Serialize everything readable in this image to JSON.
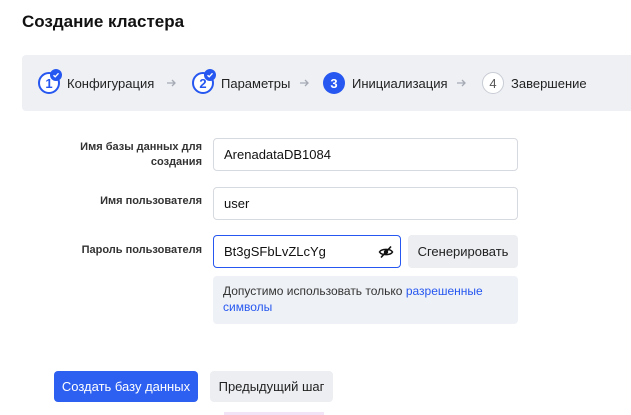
{
  "page": {
    "title": "Создание кластера"
  },
  "stepper": {
    "steps": [
      {
        "number": "1",
        "label": "Конфигурация",
        "state": "done"
      },
      {
        "number": "2",
        "label": "Параметры",
        "state": "done"
      },
      {
        "number": "3",
        "label": "Инициализация",
        "state": "active"
      },
      {
        "number": "4",
        "label": "Завершение",
        "state": "todo"
      }
    ]
  },
  "form": {
    "db_name": {
      "label_line1": "Имя базы данных для",
      "label_line2": "создания",
      "value": "ArenadataDB1084"
    },
    "username": {
      "label": "Имя пользователя",
      "value": "user"
    },
    "password": {
      "label": "Пароль пользователя",
      "value": "Bt3gSFbLvZLcYg",
      "visibility_icon": "eye-off-icon"
    },
    "generate_label": "Сгенерировать",
    "hint": {
      "text": "Допустимо использовать только ",
      "link_line1": "разрешенные",
      "link_line2": "символы"
    }
  },
  "actions": {
    "create_label": "Создать базу данных",
    "previous_label": "Предыдущий шаг"
  },
  "colors": {
    "accent": "#2657f0",
    "stepper_bg": "#eef0f4"
  }
}
